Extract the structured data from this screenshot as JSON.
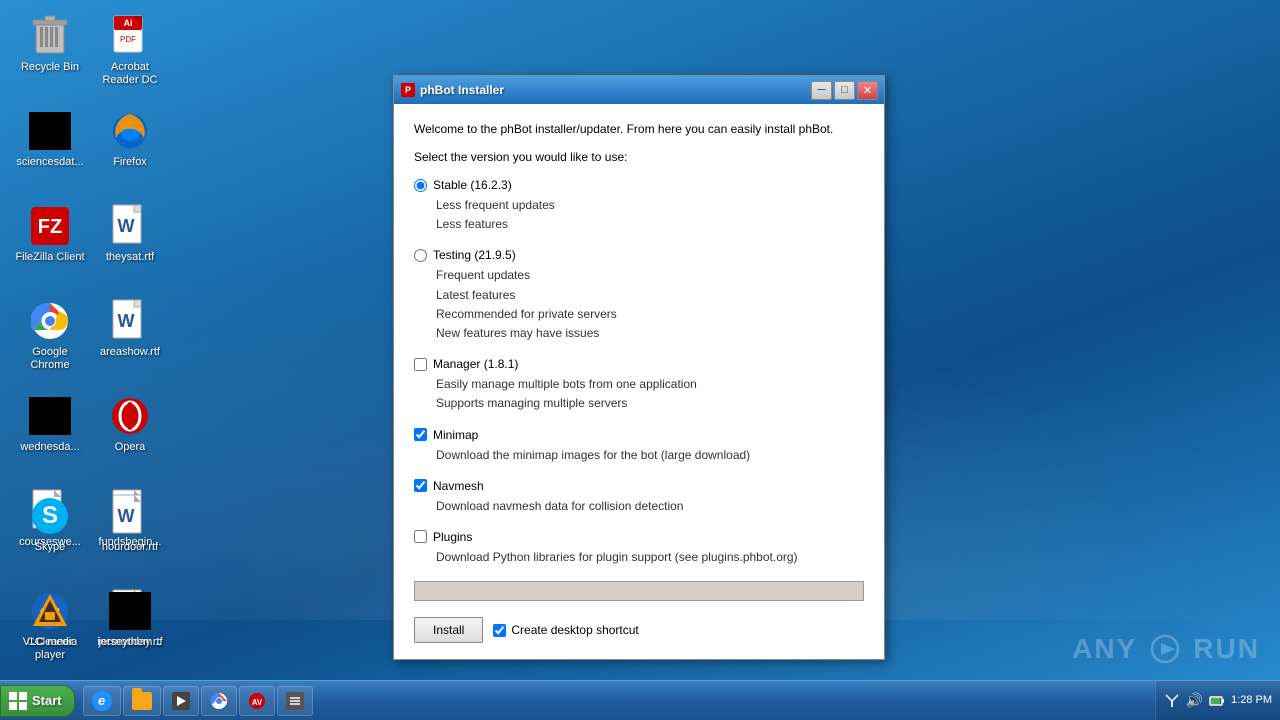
{
  "desktop": {
    "background_color": "#1a6dab"
  },
  "desktop_icons": [
    {
      "id": "recycle-bin",
      "label": "Recycle Bin",
      "icon_type": "recycle"
    },
    {
      "id": "acrobat",
      "label": "Acrobat Reader DC",
      "icon_type": "acrobat"
    },
    {
      "id": "sciencesdat",
      "label": "sciencesdat...",
      "icon_type": "black-rect"
    },
    {
      "id": "firefox",
      "label": "Firefox",
      "icon_type": "firefox"
    },
    {
      "id": "filezilla",
      "label": "FileZilla Client",
      "icon_type": "filezilla"
    },
    {
      "id": "theysat",
      "label": "theysat.rtf",
      "icon_type": "word"
    },
    {
      "id": "chrome",
      "label": "Google Chrome",
      "icon_type": "chrome"
    },
    {
      "id": "areashow",
      "label": "areashow.rtf",
      "icon_type": "word"
    },
    {
      "id": "wednesday",
      "label": "wednesda...",
      "icon_type": "black-rect"
    },
    {
      "id": "opera",
      "label": "Opera",
      "icon_type": "opera"
    },
    {
      "id": "courseswe",
      "label": "courseswe...",
      "icon_type": "word"
    },
    {
      "id": "fundsbegin",
      "label": "fundsbegin...",
      "icon_type": "word"
    },
    {
      "id": "skype",
      "label": "Skype",
      "icon_type": "skype"
    },
    {
      "id": "hourdoor",
      "label": "hourdoor.rtf",
      "icon_type": "word"
    },
    {
      "id": "ccleaner",
      "label": "CCleaner",
      "icon_type": "ccleaner"
    },
    {
      "id": "incmonday",
      "label": "incmonday.rtf",
      "icon_type": "word"
    },
    {
      "id": "vlc",
      "label": "VLC media player",
      "icon_type": "vlc"
    },
    {
      "id": "jerseythem",
      "label": "jerseythem...",
      "icon_type": "black-rect"
    }
  ],
  "installer": {
    "title": "phBot Installer",
    "welcome_text": "Welcome to the phBot installer/updater. From here you can easily install phBot.",
    "select_label": "Select the version you would like to use:",
    "versions": [
      {
        "id": "stable",
        "type": "radio",
        "label": "Stable (16.2.3)",
        "checked": true,
        "details": [
          "Less frequent updates",
          "Less features"
        ]
      },
      {
        "id": "testing",
        "type": "radio",
        "label": "Testing (21.9.5)",
        "checked": false,
        "details": [
          "Frequent updates",
          "Latest features",
          "Recommended for private servers",
          "New features may have issues"
        ]
      },
      {
        "id": "manager",
        "type": "checkbox",
        "label": "Manager (1.8.1)",
        "checked": false,
        "details": [
          "Easily manage multiple bots from one application",
          "Supports managing multiple servers"
        ]
      },
      {
        "id": "minimap",
        "type": "checkbox",
        "label": "Minimap",
        "checked": true,
        "details": [
          "Download the minimap images for the bot (large download)"
        ]
      },
      {
        "id": "navmesh",
        "type": "checkbox",
        "label": "Navmesh",
        "checked": true,
        "details": [
          "Download navmesh data for collision detection"
        ]
      },
      {
        "id": "plugins",
        "type": "checkbox",
        "label": "Plugins",
        "checked": false,
        "details": [
          "Download Python libraries for plugin support (see plugins.phbot.org)"
        ]
      }
    ],
    "install_button_label": "Install",
    "create_shortcut_label": "Create desktop shortcut",
    "create_shortcut_checked": true,
    "progress": 0
  },
  "taskbar": {
    "start_label": "Start",
    "time": "1:28 PM",
    "date": ""
  },
  "anyrun": {
    "text": "ANY ▶ RUN"
  },
  "window_controls": {
    "minimize": "─",
    "maximize": "□",
    "close": "✕"
  }
}
